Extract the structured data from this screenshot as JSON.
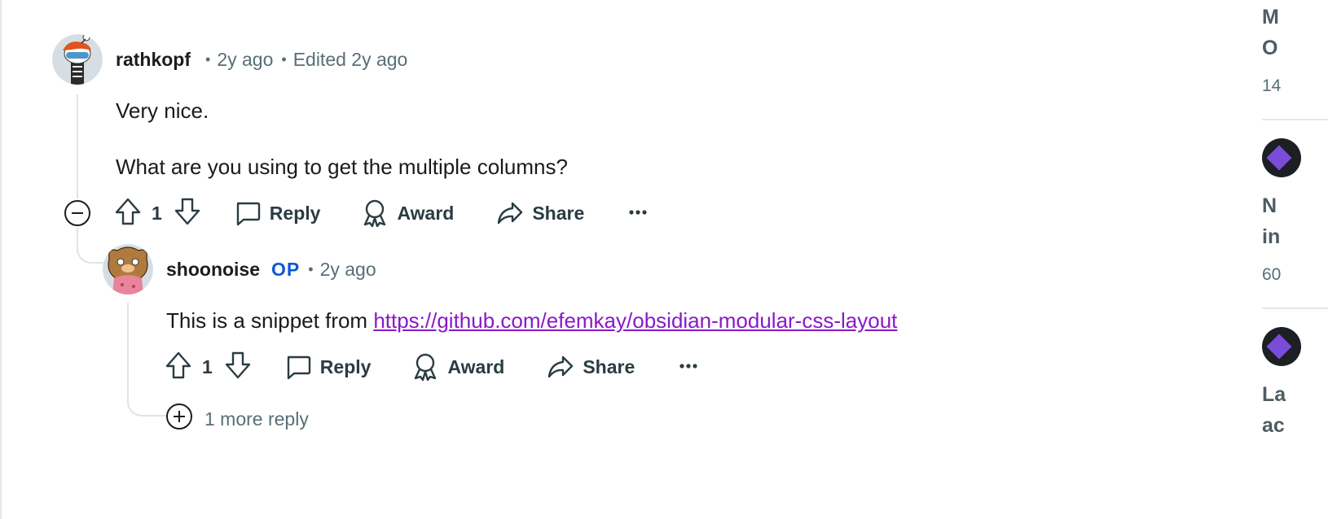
{
  "comments": [
    {
      "author": "rathkopf",
      "age": "2y ago",
      "edited": "Edited 2y ago",
      "body": [
        "Very nice.",
        "What are you using to get the multiple columns?"
      ],
      "votes": "1",
      "actions": {
        "reply": "Reply",
        "award": "Award",
        "share": "Share"
      }
    },
    {
      "author": "shoonoise",
      "badge": "OP",
      "age": "2y ago",
      "body_prefix": "This is a snippet from ",
      "link": "https://github.com/efemkay/obsidian-modular-css-layout",
      "votes": "1",
      "actions": {
        "reply": "Reply",
        "award": "Award",
        "share": "Share"
      },
      "more_replies": "1 more reply"
    }
  ],
  "sidebar": [
    {
      "title_lines": [
        "M",
        "O"
      ],
      "sub": "14"
    },
    {
      "title_lines": [
        "N",
        "in"
      ],
      "sub": "60"
    },
    {
      "title_lines": [
        "La",
        "ac"
      ]
    }
  ],
  "colors": {
    "link": "#8a18c8",
    "op_badge": "#0e58d6",
    "meta": "#576f76"
  },
  "icons": [
    "upvote-icon",
    "downvote-icon",
    "comment-icon",
    "award-icon",
    "share-icon",
    "more-icon",
    "collapse-icon",
    "expand-icon"
  ]
}
